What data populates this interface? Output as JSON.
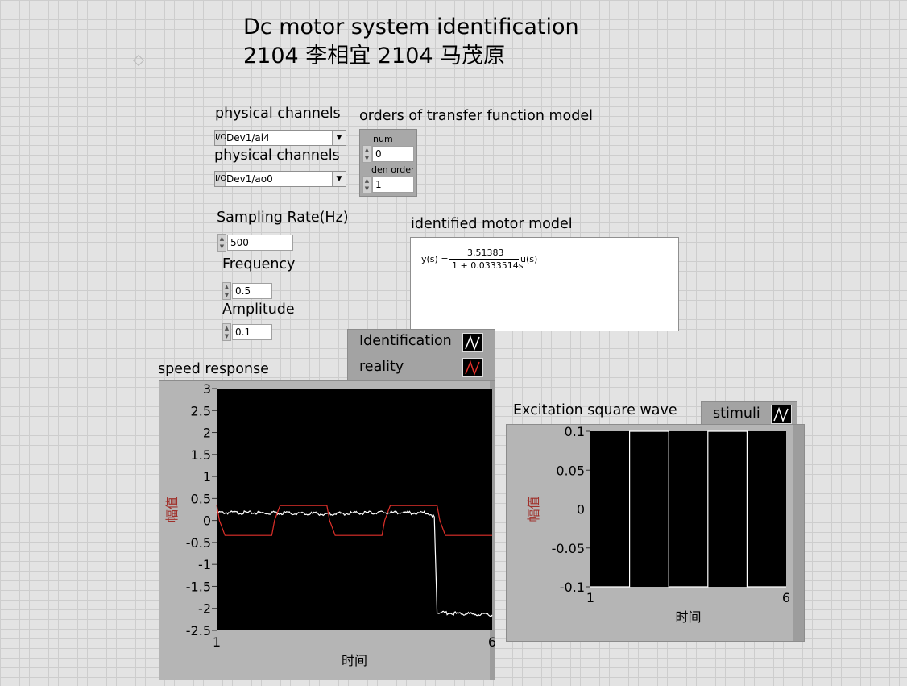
{
  "header": {
    "title_line1": "Dc motor system identification",
    "title_line2": "2104  李相宜 2104 马茂原"
  },
  "controls": {
    "physical_channels_in": {
      "label": "physical channels",
      "value": "Dev1/ai4"
    },
    "physical_channels_out": {
      "label": "physical channels",
      "value": "Dev1/ao0"
    },
    "orders": {
      "label": "orders of transfer function model",
      "num_label": "num order",
      "num_value": "0",
      "den_label": "den order",
      "den_value": "1"
    },
    "sampling_rate": {
      "label": "Sampling Rate(Hz)",
      "value": "500"
    },
    "frequency": {
      "label": "Frequency",
      "value": "0.5"
    },
    "amplitude": {
      "label": "Amplitude",
      "value": "0.1"
    }
  },
  "model": {
    "label": "identified motor model",
    "lhs": "y(s) =",
    "numerator": "3.51383",
    "denominator": "1 + 0.0333514s",
    "rhs": "u(s)"
  },
  "speed_chart": {
    "label": "speed response",
    "legend": [
      "Identification",
      "reality"
    ],
    "y_axis_label": "幅值",
    "x_axis_label": "时间",
    "y_ticks": [
      "3",
      "2.5",
      "2",
      "1.5",
      "1",
      "0.5",
      "0",
      "-0.5",
      "-1",
      "-1.5",
      "-2",
      "-2.5"
    ],
    "x_ticks": [
      "1",
      "6"
    ]
  },
  "stim_chart": {
    "label": "Excitation square wave",
    "legend": [
      "stimuli"
    ],
    "y_axis_label": "幅值",
    "x_axis_label": "时间",
    "y_ticks": [
      "0.1",
      "0.05",
      "0",
      "-0.05",
      "-0.1"
    ],
    "x_ticks": [
      "1",
      "6"
    ]
  },
  "colors": {
    "plot_bg": "#000000",
    "identification": "#ffffff",
    "reality": "#e0302a",
    "stimuli": "#ffffff"
  },
  "chart_data": [
    {
      "type": "line",
      "title": "speed response",
      "xlabel": "时间",
      "ylabel": "幅值",
      "xlim": [
        1,
        6
      ],
      "ylim": [
        -2.5,
        3
      ],
      "grid": false,
      "legend": "top-right",
      "series": [
        {
          "name": "Identification",
          "color": "#ffffff",
          "x": [
            1.0,
            2.0,
            3.0,
            4.0,
            4.8,
            4.95,
            5.0,
            6.0
          ],
          "y": [
            0.18,
            0.17,
            0.15,
            0.18,
            0.17,
            0.1,
            -2.1,
            -2.15
          ]
        },
        {
          "name": "reality",
          "color": "#e0302a",
          "x": [
            1.0,
            1.05,
            1.15,
            2.0,
            2.05,
            2.15,
            3.0,
            3.05,
            3.15,
            4.0,
            4.05,
            4.15,
            5.0,
            5.05,
            5.15,
            6.0
          ],
          "y": [
            0.35,
            0.0,
            -0.34,
            -0.34,
            0.0,
            0.34,
            0.34,
            0.0,
            -0.34,
            -0.34,
            0.0,
            0.34,
            0.34,
            0.0,
            -0.34,
            -0.34
          ]
        }
      ]
    },
    {
      "type": "line",
      "title": "Excitation square wave",
      "xlabel": "时间",
      "ylabel": "幅值",
      "xlim": [
        1,
        6
      ],
      "ylim": [
        -0.1,
        0.1
      ],
      "grid": false,
      "legend": "top-right",
      "series": [
        {
          "name": "stimuli",
          "color": "#ffffff",
          "x": [
            1.0,
            2.0,
            2.0,
            3.0,
            3.0,
            4.0,
            4.0,
            5.0,
            5.0,
            6.0
          ],
          "y": [
            -0.1,
            -0.1,
            0.1,
            0.1,
            -0.1,
            -0.1,
            0.1,
            0.1,
            -0.1,
            -0.1
          ]
        }
      ]
    }
  ]
}
